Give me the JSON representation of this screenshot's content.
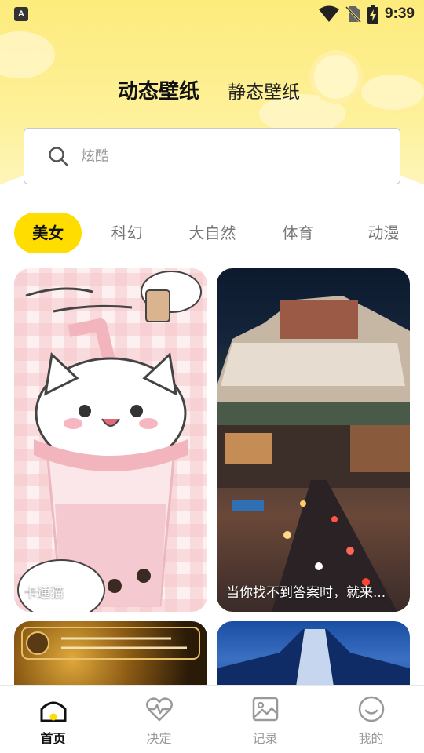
{
  "status_bar": {
    "app_icon_letter": "A",
    "time": "9:39"
  },
  "top_tabs": {
    "active": "动态壁纸",
    "inactive": "静态壁纸"
  },
  "search": {
    "placeholder": "炫酷"
  },
  "categories": [
    "美女",
    "科幻",
    "大自然",
    "体育",
    "动漫"
  ],
  "cards": [
    {
      "caption": "卡通猫"
    },
    {
      "caption": "当你找不到答案时，就来..."
    },
    {
      "caption": ""
    },
    {
      "caption": ""
    }
  ],
  "bottom_nav": [
    {
      "label": "首页",
      "icon": "home-icon",
      "active": true
    },
    {
      "label": "决定",
      "icon": "heart-pulse-icon",
      "active": false
    },
    {
      "label": "记录",
      "icon": "image-icon",
      "active": false
    },
    {
      "label": "我的",
      "icon": "smiley-icon",
      "active": false
    }
  ],
  "colors": {
    "accent": "#ffdd00",
    "header_yellow": "#fdeb7c"
  }
}
